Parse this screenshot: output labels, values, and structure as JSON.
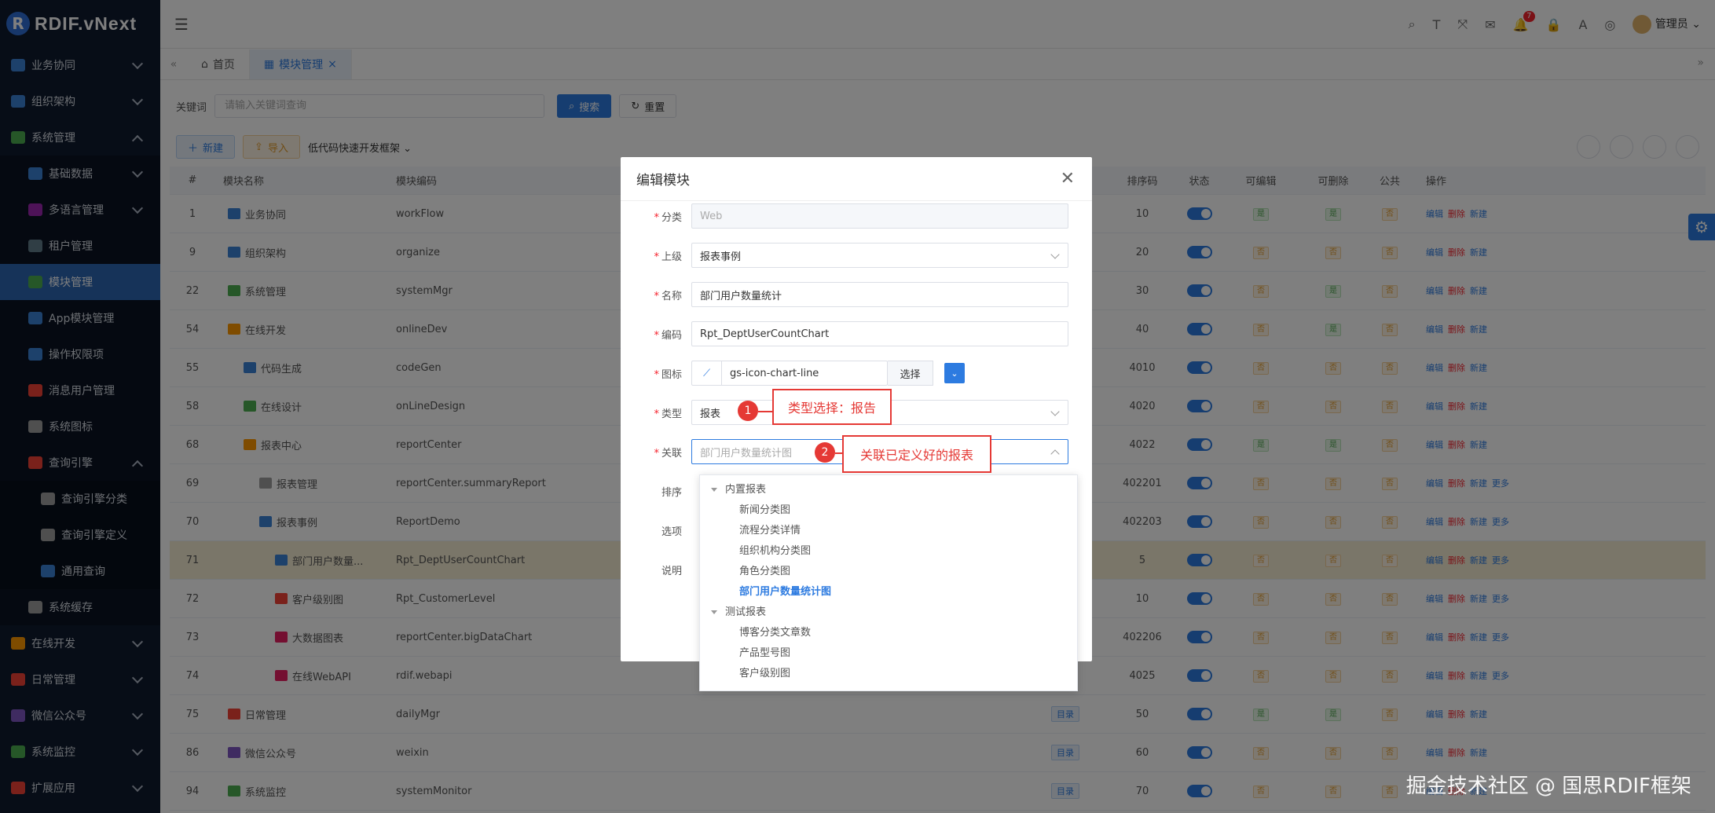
{
  "app": {
    "logo_letter": "R",
    "logo_text": "RDIF.vNext"
  },
  "sidebar": {
    "items": [
      {
        "label": "业务协同",
        "icon": "briefcase-icon",
        "color": "#3b82d6"
      },
      {
        "label": "组织架构",
        "icon": "org-icon",
        "color": "#3b82d6"
      },
      {
        "label": "系统管理",
        "icon": "gear-icon",
        "color": "#4caf50"
      },
      {
        "label": "基础数据",
        "icon": "database-icon",
        "color": "#3b82d6"
      },
      {
        "label": "多语言管理",
        "icon": "globe-icon",
        "color": "#9c27b0"
      },
      {
        "label": "租户管理",
        "icon": "tenant-icon",
        "color": "#607d8b"
      },
      {
        "label": "模块管理",
        "icon": "module-icon",
        "color": "#4caf50"
      },
      {
        "label": "App模块管理",
        "icon": "app-icon",
        "color": "#3b82d6"
      },
      {
        "label": "操作权限项",
        "icon": "key-icon",
        "color": "#3b82d6"
      },
      {
        "label": "消息用户管理",
        "icon": "user-icon",
        "color": "#f44336"
      },
      {
        "label": "系统图标",
        "icon": "image-icon",
        "color": "#9e9e9e"
      },
      {
        "label": "查询引擎",
        "icon": "query-icon",
        "color": "#f44336"
      },
      {
        "label": "查询引擎分类",
        "icon": "list-icon",
        "color": "#9e9e9e"
      },
      {
        "label": "查询引擎定义",
        "icon": "flask-icon",
        "color": "#9e9e9e"
      },
      {
        "label": "通用查询",
        "icon": "search-doc-icon",
        "color": "#3b82d6"
      },
      {
        "label": "系统缓存",
        "icon": "layers-icon",
        "color": "#9e9e9e"
      },
      {
        "label": "在线开发",
        "icon": "grid-icon",
        "color": "#ff9800"
      },
      {
        "label": "日常管理",
        "icon": "calendar-icon",
        "color": "#f44336"
      },
      {
        "label": "微信公众号",
        "icon": "wechat-icon",
        "color": "#7e57c2"
      },
      {
        "label": "系统监控",
        "icon": "monitor-icon",
        "color": "#4caf50"
      },
      {
        "label": "扩展应用",
        "icon": "apps-icon",
        "color": "#f44336"
      }
    ]
  },
  "header": {
    "user": "管理员",
    "badge": "7"
  },
  "tabs": [
    {
      "label": "首页",
      "icon": "home-icon"
    },
    {
      "label": "模块管理",
      "icon": "grid-icon",
      "close": "×"
    }
  ],
  "search": {
    "label": "关键词",
    "placeholder": "请输入关键词查询",
    "search_btn": "搜索",
    "reset_btn": "重置"
  },
  "toolbar": {
    "new_btn": "新建",
    "import_btn": "导入",
    "framework": "低代码快速开发框架"
  },
  "table": {
    "headers": {
      "num": "#",
      "name": "模块名称",
      "code": "模块编码",
      "sort": "排序码",
      "status": "状态",
      "editable": "可编辑",
      "deletable": "可删除",
      "public": "公共",
      "ops": "操作"
    },
    "rows": [
      {
        "num": "1",
        "name": "业务协同",
        "code": "workFlow",
        "tag": "",
        "sort": "10",
        "edit": "是",
        "del": "是",
        "pub": "否",
        "more": ""
      },
      {
        "num": "9",
        "name": "组织架构",
        "code": "organize",
        "tag": "",
        "sort": "20",
        "edit": "否",
        "del": "否",
        "pub": "否",
        "more": ""
      },
      {
        "num": "22",
        "name": "系统管理",
        "code": "systemMgr",
        "tag": "",
        "sort": "30",
        "edit": "否",
        "del": "是",
        "pub": "否",
        "more": ""
      },
      {
        "num": "54",
        "name": "在线开发",
        "code": "onlineDev",
        "tag": "",
        "sort": "40",
        "edit": "否",
        "del": "是",
        "pub": "否",
        "more": ""
      },
      {
        "num": "55",
        "name": "代码生成",
        "code": "codeGen",
        "tag": "",
        "sort": "4010",
        "edit": "否",
        "del": "否",
        "pub": "否",
        "more": ""
      },
      {
        "num": "58",
        "name": "在线设计",
        "code": "onLineDesign",
        "tag": "",
        "sort": "4020",
        "edit": "否",
        "del": "否",
        "pub": "否",
        "more": ""
      },
      {
        "num": "68",
        "name": "报表中心",
        "code": "reportCenter",
        "tag": "",
        "sort": "4022",
        "edit": "是",
        "del": "是",
        "pub": "否",
        "more": ""
      },
      {
        "num": "69",
        "name": "报表管理",
        "code": "reportCenter.summaryReport",
        "tag": "",
        "sort": "402201",
        "edit": "否",
        "del": "否",
        "pub": "否",
        "more": "更多"
      },
      {
        "num": "70",
        "name": "报表事例",
        "code": "ReportDemo",
        "tag": "",
        "sort": "402203",
        "edit": "否",
        "del": "否",
        "pub": "否",
        "more": "更多"
      },
      {
        "num": "71",
        "name": "部门用户数量...",
        "code": "Rpt_DeptUserCountChart",
        "tag": "",
        "sort": "5",
        "edit": "否",
        "del": "否",
        "pub": "否",
        "more": "更多"
      },
      {
        "num": "72",
        "name": "客户级别图",
        "code": "Rpt_CustomerLevel",
        "tag": "",
        "sort": "10",
        "edit": "否",
        "del": "否",
        "pub": "否",
        "more": "更多"
      },
      {
        "num": "73",
        "name": "大数据图表",
        "code": "reportCenter.bigDataChart",
        "tag": "",
        "sort": "402206",
        "edit": "否",
        "del": "否",
        "pub": "否",
        "more": "更多"
      },
      {
        "num": "74",
        "name": "在线WebAPI",
        "code": "rdif.webapi",
        "tag": "",
        "sort": "4025",
        "edit": "否",
        "del": "否",
        "pub": "否",
        "more": "更多"
      },
      {
        "num": "75",
        "name": "日常管理",
        "code": "dailyMgr",
        "tag": "目录",
        "sort": "50",
        "edit": "是",
        "del": "是",
        "pub": "否",
        "more": ""
      },
      {
        "num": "86",
        "name": "微信公众号",
        "code": "weixin",
        "tag": "目录",
        "sort": "60",
        "edit": "否",
        "del": "否",
        "pub": "否",
        "more": ""
      },
      {
        "num": "94",
        "name": "系统监控",
        "code": "systemMonitor",
        "tag": "目录",
        "sort": "70",
        "edit": "否",
        "del": "否",
        "pub": "否",
        "more": ""
      }
    ],
    "op_edit": "编辑",
    "op_delete": "删除",
    "op_new": "新建"
  },
  "dialog": {
    "title": "编辑模块",
    "category_label": "分类",
    "category_value": "Web",
    "parent_label": "上级",
    "parent_value": "报表事例",
    "name_label": "名称",
    "name_value": "部门用户数量统计",
    "code_label": "编码",
    "code_value": "Rpt_DeptUserCountChart",
    "icon_label": "图标",
    "icon_value": "gs-icon-chart-line",
    "icon_select": "选择",
    "type_label": "类型",
    "type_value": "报表",
    "link_label": "关联",
    "link_placeholder": "部门用户数量统计图",
    "sort_label": "排序",
    "options_label": "选项",
    "desc_label": "说明"
  },
  "dropdown": {
    "groups": [
      {
        "label": "内置报表",
        "items": [
          "新闻分类图",
          "流程分类详情",
          "组织机构分类图",
          "角色分类图",
          "部门用户数量统计图"
        ]
      },
      {
        "label": "测试报表",
        "items": [
          "博客分类文章数",
          "产品型号图",
          "客户级别图"
        ]
      }
    ],
    "selected": "部门用户数量统计图"
  },
  "annotations": {
    "a1_num": "1",
    "a1_text": "类型选择：报告",
    "a2_num": "2",
    "a2_text": "关联已定义好的报表"
  },
  "watermark": "掘金技术社区 @ 国思RDIF框架"
}
